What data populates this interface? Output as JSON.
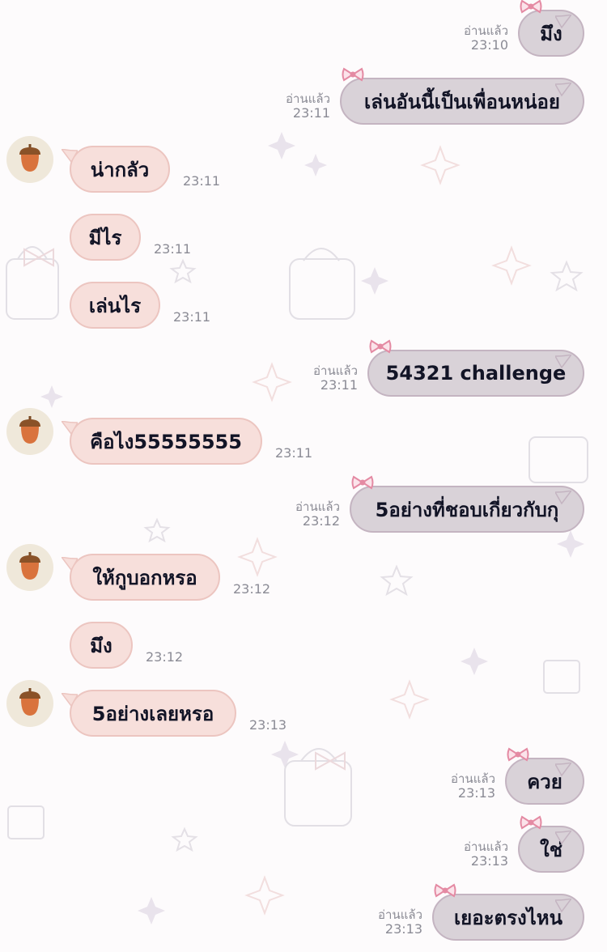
{
  "read_label": "อ่านแล้ว",
  "messages": [
    {
      "side": "out",
      "text": "มึง",
      "time": "23:10",
      "read": true
    },
    {
      "side": "out",
      "text": "เล่นอันนี้เป็นเพื่อนหน่อย",
      "time": "23:11",
      "read": true
    },
    {
      "side": "in",
      "text": "น่ากลัว",
      "time": "23:11",
      "avatar": true
    },
    {
      "side": "in",
      "text": "มีไร",
      "time": "23:11",
      "avatar": false
    },
    {
      "side": "in",
      "text": "เล่นไร",
      "time": "23:11",
      "avatar": false
    },
    {
      "side": "out",
      "text": "54321 challenge",
      "time": "23:11",
      "read": true
    },
    {
      "side": "in",
      "text": "คือไง55555555",
      "time": "23:11",
      "avatar": true
    },
    {
      "side": "out",
      "text": "5อย่างที่ชอบเกี่ยวกับกุ",
      "time": "23:12",
      "read": true
    },
    {
      "side": "in",
      "text": "ให้กูบอกหรอ",
      "time": "23:12",
      "avatar": true
    },
    {
      "side": "in",
      "text": "มึง",
      "time": "23:12",
      "avatar": false
    },
    {
      "side": "in",
      "text": "5อย่างเลยหรอ",
      "time": "23:13",
      "avatar": true
    },
    {
      "side": "out",
      "text": "ควย",
      "time": "23:13",
      "read": true
    },
    {
      "side": "out",
      "text": "ใช่",
      "time": "23:13",
      "read": true
    },
    {
      "side": "out",
      "text": "เยอะตรงไหน",
      "time": "23:13",
      "read": true
    }
  ],
  "avatar_icon": "acorn-icon",
  "read_decoration_icon": "bow-icon",
  "colors": {
    "background": "#fdfbfc",
    "outgoing_bubble": "#d9d2d8",
    "incoming_bubble": "#f7dfdb",
    "text": "#121426",
    "meta_text": "#8b8b95",
    "bow": "#e48aa3",
    "acorn": "#d9733d"
  }
}
